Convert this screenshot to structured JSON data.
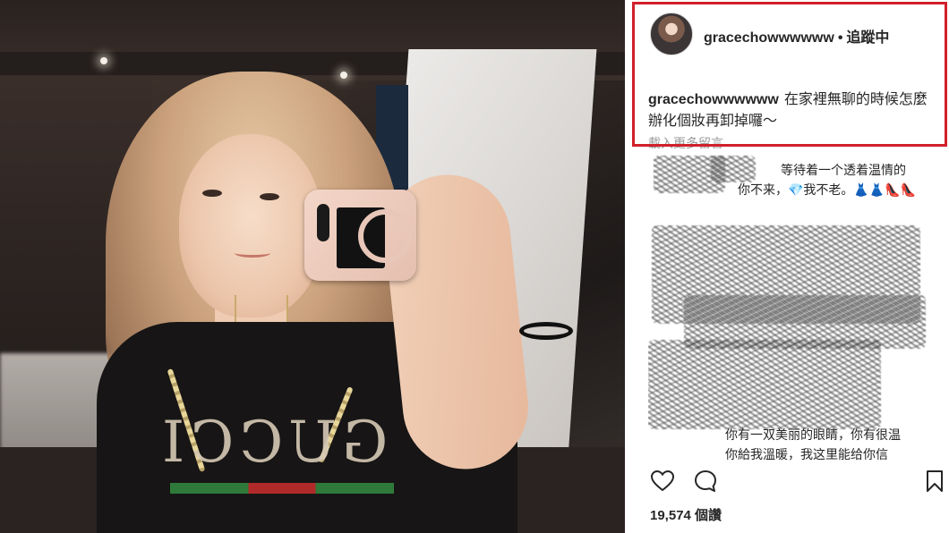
{
  "post": {
    "username": "gracechowwwwww",
    "separator": "•",
    "follow_label": "追蹤中",
    "caption_user": "gracechowwwwww",
    "caption_text": "在家裡無聊的時候怎麼辦化個妝再卸掉囉～",
    "load_more_label": "載入更多留言",
    "likes_label": "19,574 個讚"
  },
  "comments": {
    "line1": "等待着一个透着温情的",
    "line2": "你不来，💎我不老。👗👗👠👠",
    "line3": "你有一双美丽的眼睛，你有很温",
    "line4": "你給我溫暖，我这里能给你信"
  },
  "photo": {
    "shirt_logo": "GUCCI"
  },
  "icons": {
    "like": "heart-icon",
    "comment": "comment-icon",
    "save": "bookmark-icon",
    "avatar": "avatar"
  },
  "colors": {
    "highlight_border": "#d0202b",
    "text": "#262626",
    "muted": "#999999"
  }
}
